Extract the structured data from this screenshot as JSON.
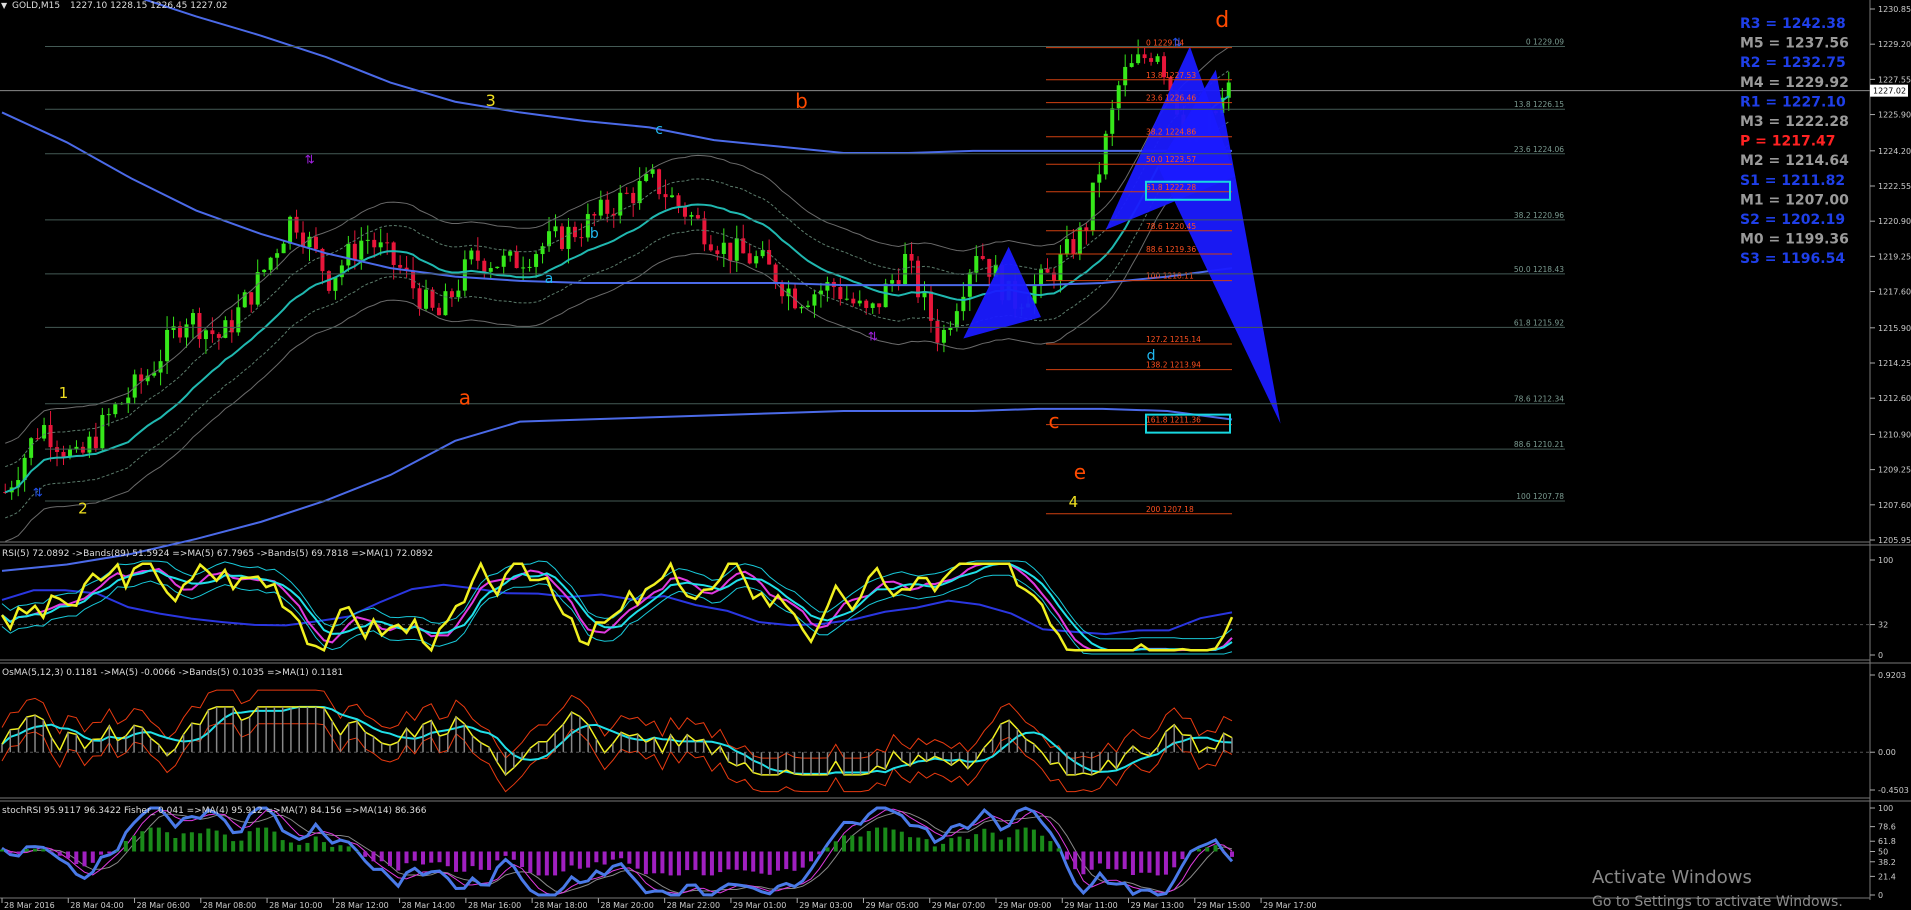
{
  "header": {
    "symbol": "GOLD,M15",
    "ohlc": "1227.10 1228.15 1226.45 1227.02"
  },
  "chart_data": [
    {
      "type": "candlestick",
      "panel": "main",
      "ylim": [
        1205.95,
        1230.85
      ],
      "price_ticks": [
        "1230.85",
        "1229.20",
        "1227.55",
        "1225.90",
        "1224.20",
        "1222.55",
        "1220.90",
        "1219.25",
        "1217.60",
        "1215.90",
        "1214.25",
        "1212.60",
        "1210.90",
        "1209.25",
        "1207.60",
        "1205.95"
      ],
      "current_price": "1227.02",
      "x_labels": [
        "28 Mar 2016",
        "28 Mar 04:00",
        "28 Mar 06:00",
        "28 Mar 08:00",
        "28 Mar 10:00",
        "28 Mar 12:00",
        "28 Mar 14:00",
        "28 Mar 16:00",
        "28 Mar 18:00",
        "28 Mar 20:00",
        "28 Mar 22:00",
        "29 Mar 01:00",
        "29 Mar 03:00",
        "29 Mar 05:00",
        "29 Mar 07:00",
        "29 Mar 09:00",
        "29 Mar 11:00",
        "29 Mar 13:00",
        "29 Mar 15:00",
        "29 Mar 17:00"
      ],
      "close_path": [
        1208.2,
        1211.4,
        1209.6,
        1212.0,
        1213.8,
        1216.5,
        1215.4,
        1218.0,
        1221.2,
        1218.2,
        1220.2,
        1218.6,
        1216.3,
        1219.2,
        1218.9,
        1219.8,
        1220.6,
        1221.8,
        1222.8,
        1221.2,
        1219.6,
        1219.0,
        1217.3,
        1217.9,
        1216.4,
        1219.1,
        1215.3,
        1219.7,
        1217.1,
        1218.3,
        1220.5,
        1227.6,
        1229.1,
        1224.2,
        1227.0
      ],
      "pivots": [
        {
          "label": "R3 = 1242.38",
          "color": "#1f3fe8"
        },
        {
          "label": "M5 = 1237.56",
          "color": "#9a9a9a"
        },
        {
          "label": "R2 = 1232.75",
          "color": "#1f3fe8"
        },
        {
          "label": "M4 = 1229.92",
          "color": "#9a9a9a"
        },
        {
          "label": "R1 = 1227.10",
          "color": "#1f3fe8"
        },
        {
          "label": "M3 = 1222.28",
          "color": "#9a9a9a"
        },
        {
          "label": "P   = 1217.47",
          "color": "#ff2222"
        },
        {
          "label": "M2 = 1214.64",
          "color": "#9a9a9a"
        },
        {
          "label": "S1 = 1211.82",
          "color": "#1f3fe8"
        },
        {
          "label": "M1 = 1207.00",
          "color": "#9a9a9a"
        },
        {
          "label": "S2 = 1202.19",
          "color": "#1f3fe8"
        },
        {
          "label": "M0 = 1199.36",
          "color": "#9a9a9a"
        },
        {
          "label": "S3 = 1196.54",
          "color": "#1f3fe8"
        }
      ],
      "fib_levels_orange": [
        {
          "label": "0 1229.04",
          "value": 1229.04
        },
        {
          "label": "13.8 1227.53",
          "value": 1227.53
        },
        {
          "label": "23.6 1226.46",
          "value": 1226.46
        },
        {
          "label": "38.2 1224.86",
          "value": 1224.86
        },
        {
          "label": "50.0 1223.57",
          "value": 1223.57
        },
        {
          "label": "61.8 1222.28",
          "value": 1222.28
        },
        {
          "label": "78.6 1220.45",
          "value": 1220.45
        },
        {
          "label": "88.6 1219.36",
          "value": 1219.36
        },
        {
          "label": "100 1218.11",
          "value": 1218.11
        },
        {
          "label": "127.2 1215.14",
          "value": 1215.14
        },
        {
          "label": "138.2 1213.94",
          "value": 1213.94
        },
        {
          "label": "161.8 1211.36",
          "value": 1211.36
        },
        {
          "label": "200 1207.18",
          "value": 1207.18
        }
      ],
      "fib_levels_gray": [
        {
          "label": "0 1229.09",
          "value": 1229.09
        },
        {
          "label": "13.8 1226.15",
          "value": 1226.15
        },
        {
          "label": "23.6 1224.06",
          "value": 1224.06
        },
        {
          "label": "38.2 1220.96",
          "value": 1220.96
        },
        {
          "label": "50.0 1218.43",
          "value": 1218.43
        },
        {
          "label": "61.8 1215.92",
          "value": 1215.92
        },
        {
          "label": "78.6 1212.34",
          "value": 1212.34
        },
        {
          "label": "88.6 1210.21",
          "value": 1210.21
        },
        {
          "label": "100 1207.78",
          "value": 1207.78
        }
      ],
      "wave_labels": [
        {
          "text": "1",
          "color": "#f0e020"
        },
        {
          "text": "2",
          "color": "#f0e020"
        },
        {
          "text": "3",
          "color": "#f0e020"
        },
        {
          "text": "4",
          "color": "#f0e020"
        },
        {
          "text": "a",
          "color": "#ff4a00"
        },
        {
          "text": "b",
          "color": "#ff4a00"
        },
        {
          "text": "c",
          "color": "#ff4a00"
        },
        {
          "text": "d",
          "color": "#ff4a00"
        },
        {
          "text": "e",
          "color": "#ff4a00"
        },
        {
          "text": "a",
          "color": "#20b8f0"
        },
        {
          "text": "b",
          "color": "#20b8f0"
        },
        {
          "text": "c",
          "color": "#20b8f0"
        },
        {
          "text": "d",
          "color": "#20b8f0"
        }
      ]
    },
    {
      "type": "line",
      "panel": "rsi",
      "title": "RSI(5) 72.0892 ->Bands(89) 51.5924 =>MA(5) 67.7965 ->Bands(5) 69.7818 =>MA(1) 72.0892",
      "ylim": [
        0,
        100
      ],
      "ticks": [
        "100",
        "32",
        "0"
      ]
    },
    {
      "type": "line",
      "panel": "osma",
      "title": "OsMA(5,12,3) 0.1181 ->MA(5) -0.0066 ->Bands(5) 0.1035 =>MA(1) 0.1181",
      "ticks": [
        "0.9203",
        "0.00",
        "-0.4503"
      ]
    },
    {
      "type": "line",
      "panel": "stochrsi",
      "title": "stochRSI 95.9117 96.3422  Fisher_ 0.041 =>MA(4) 95.912 =>MA(7) 84.156 =>MA(14) 86.366",
      "ticks": [
        "100",
        "78.6",
        "61.8",
        "50",
        "38.2",
        "21.4",
        "0"
      ]
    }
  ],
  "watermark": {
    "line1": "Activate Windows",
    "line2": "Go to Settings to activate Windows."
  }
}
